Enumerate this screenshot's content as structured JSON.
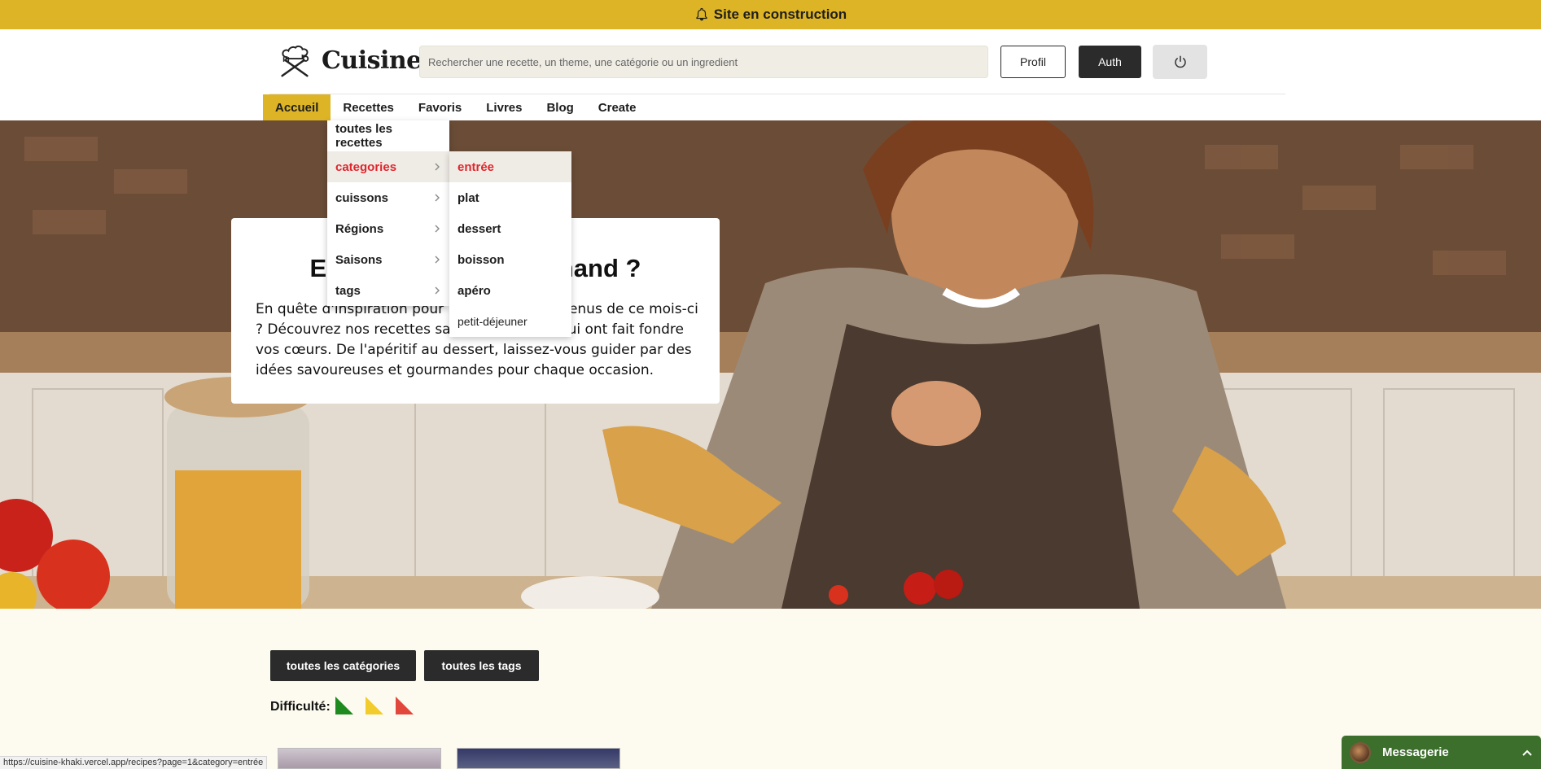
{
  "banner": {
    "icon": "bell-icon",
    "text": "Site en construction"
  },
  "header": {
    "logo_text": "Cuisine",
    "search_placeholder": "Rechercher une recette, un theme, une catégorie ou un ingredient",
    "profil_label": "Profil",
    "auth_label": "Auth",
    "power_icon": "power-icon"
  },
  "nav": {
    "items": [
      {
        "label": "Accueil",
        "active": true
      },
      {
        "label": "Recettes"
      },
      {
        "label": "Favoris"
      },
      {
        "label": "Livres"
      },
      {
        "label": "Blog"
      },
      {
        "label": "Create"
      }
    ]
  },
  "recettes_menu": {
    "items": [
      {
        "label": "toutes les recettes"
      },
      {
        "label": "categories",
        "selected": true
      },
      {
        "label": "cuissons"
      },
      {
        "label": "Régions"
      },
      {
        "label": "Saisons"
      },
      {
        "label": "tags"
      }
    ]
  },
  "categories_submenu": {
    "items": [
      "entrée",
      "plat",
      "dessert",
      "boisson",
      "apéro",
      "petit-déjeuner"
    ]
  },
  "hero": {
    "title": "Envie d'un plat gourmand ?",
    "text": "En quête d'inspiration pour renouveler vos menus de ce mois-ci ? Découvrez nos recettes salées et sucrées qui ont fait fondre vos cœurs. De l'apéritif au dessert, laissez-vous guider par des idées savoureuses et gourmandes pour chaque occasion."
  },
  "filters": {
    "all_categories": "toutes les catégories",
    "all_tags": "toutes les tags",
    "difficulty_label": "Difficulté:",
    "difficulty_colors": [
      "#1f8a1f",
      "#f2cc2c",
      "#e2473c"
    ]
  },
  "status_url": "https://cuisine-khaki.vercel.app/recipes?page=1&category=entrée",
  "messagerie": {
    "label": "Messagerie"
  }
}
